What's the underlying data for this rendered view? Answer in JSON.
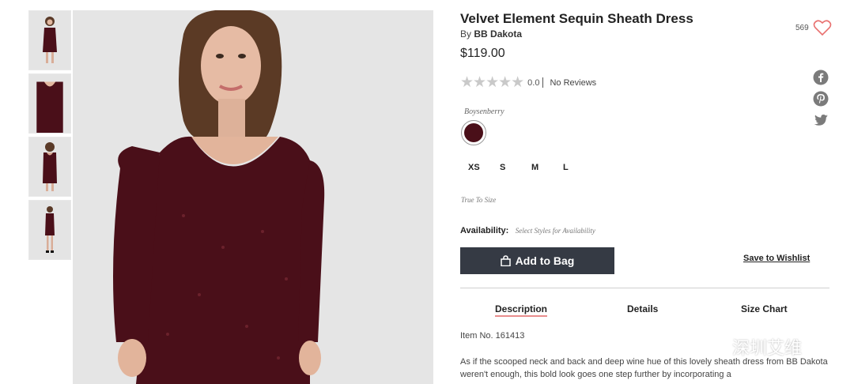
{
  "product": {
    "title": "Velvet Element Sequin Sheath Dress",
    "by_prefix": "By",
    "brand": "BB Dakota",
    "price": "$119.00",
    "likes_count": "569"
  },
  "rating": {
    "stars_filled": 0,
    "stars_total": 5,
    "value": "0.0",
    "reviews_label": "No Reviews"
  },
  "color": {
    "name": "Boysenberry",
    "swatch_hex": "#4a0f19"
  },
  "sizes": [
    "XS",
    "S",
    "M",
    "L"
  ],
  "fit_note": "True To Size",
  "availability": {
    "label": "Availability:",
    "value": "Select Styles for Availability"
  },
  "actions": {
    "add_to_bag": "Add to Bag",
    "save_to_wishlist": "Save to Wishlist"
  },
  "tabs": [
    {
      "label": "Description",
      "active": true
    },
    {
      "label": "Details",
      "active": false
    },
    {
      "label": "Size Chart",
      "active": false
    }
  ],
  "item_number": "Item No. 161413",
  "description_text": "As if the scooped neck and back and deep wine hue of this lovely sheath dress from BB Dakota weren't enough, this bold look goes one step further by incorporating a",
  "social_icons": [
    "facebook-icon",
    "pinterest-icon",
    "twitter-icon"
  ],
  "watermark": "深圳艾维",
  "colors": {
    "dress": "#4a0f19",
    "button_bg": "#353a44",
    "heart": "#e8706f",
    "tab_underline": "#e88d8d"
  }
}
